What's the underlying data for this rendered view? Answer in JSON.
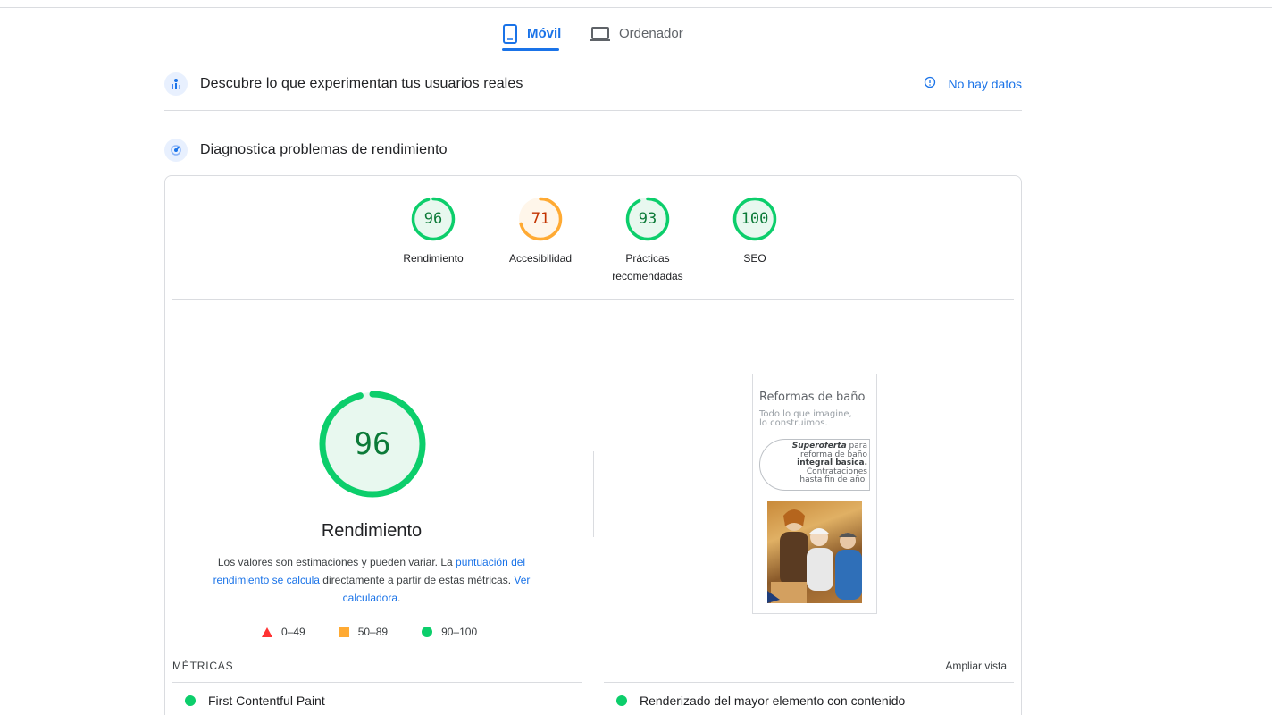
{
  "tabs": [
    {
      "label": "Móvil",
      "icon": "smartphone-icon",
      "active": true
    },
    {
      "label": "Ordenador",
      "icon": "laptop-icon",
      "active": false
    }
  ],
  "field_section": {
    "title": "Descubre lo que experimentan tus usuarios reales",
    "status": "No hay datos",
    "status_icon": "info-icon"
  },
  "lab_section": {
    "title": "Diagnostica problemas de rendimiento"
  },
  "scores": [
    {
      "value": 96,
      "label": "Rendimiento",
      "rating": "pass"
    },
    {
      "value": 71,
      "label": "Accesibilidad",
      "rating": "average"
    },
    {
      "value": 93,
      "label": "Prácticas recomendadas",
      "rating": "pass"
    },
    {
      "value": 100,
      "label": "SEO",
      "rating": "pass"
    }
  ],
  "performance": {
    "score": 96,
    "title": "Rendimiento",
    "desc_part1": "Los valores son estimaciones y pueden variar. La ",
    "desc_link1": "puntuación del rendimiento se calcula",
    "desc_part2": " directamente a partir de estas métricas. ",
    "desc_link2": "Ver calculadora",
    "desc_part3": "."
  },
  "legend": [
    {
      "shape": "triangle",
      "range": "0–49",
      "color": "#ff3333"
    },
    {
      "shape": "square",
      "range": "50–89",
      "color": "#ffaa33"
    },
    {
      "shape": "circle",
      "range": "90–100",
      "color": "#0cce6b"
    }
  ],
  "screenshot": {
    "title": "Reformas de baño",
    "subtitle_1": "Todo lo que imagine,",
    "subtitle_2": "lo construimos.",
    "offer_bold": "Superoferta",
    "offer_1": " para",
    "offer_2": "reforma de baño",
    "offer_bold2": "integral basica.",
    "offer_3": "Contrataciones",
    "offer_4": "hasta fin de año."
  },
  "metrics": {
    "header": "MÉTRICAS",
    "expand_label": "Ampliar vista",
    "items": [
      {
        "label": "First Contentful Paint",
        "rating": "pass"
      },
      {
        "label": "Renderizado del mayor elemento con contenido",
        "rating": "pass"
      }
    ]
  },
  "colors": {
    "pass": "#0cce6b",
    "average": "#ffaa33",
    "fail": "#ff3333",
    "accent": "#1a73e8"
  }
}
